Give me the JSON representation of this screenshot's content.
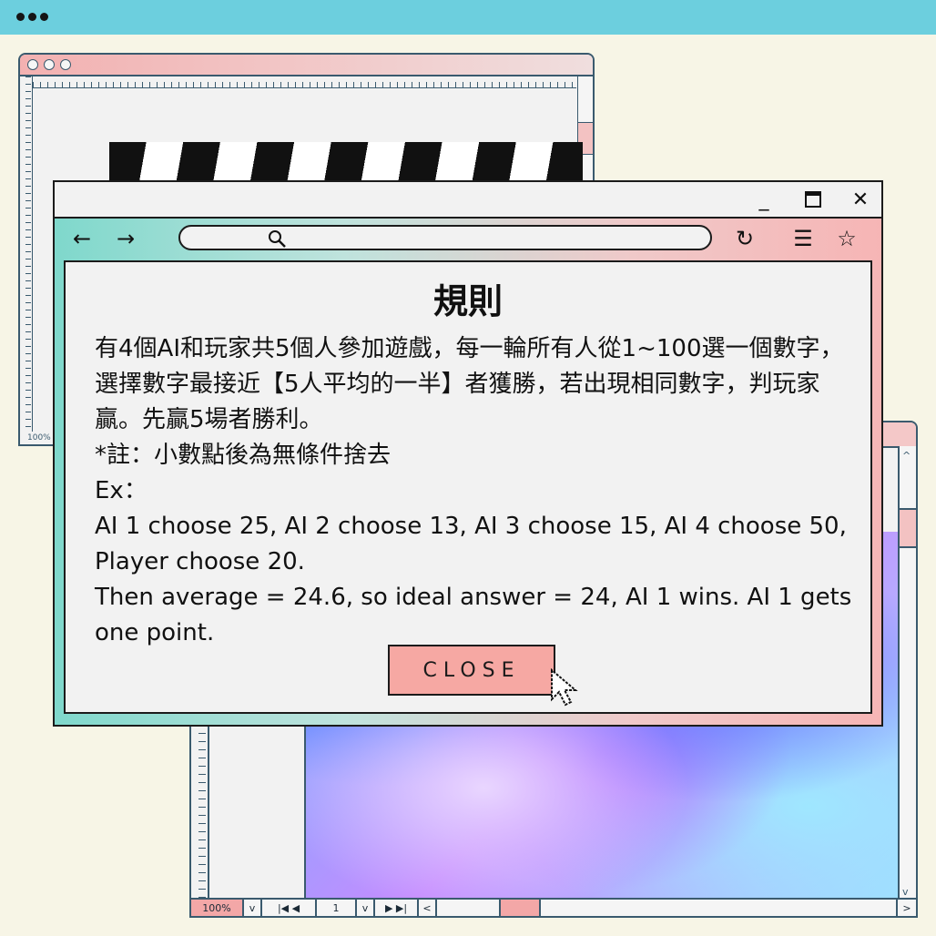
{
  "dialog": {
    "title": "規則",
    "paragraphs": [
      "有4個AI和玩家共5個人參加遊戲，每一輪所有人從1~100選一個數字，選擇數字最接近【5人平均的一半】者獲勝，若出現相同數字，判玩家贏。先贏5場者勝利。",
      "*註：小數點後為無條件捨去",
      "Ex：",
      "AI 1 choose 25, AI 2 choose 13, AI 3 choose 15, AI 4 choose 50, Player choose 20.",
      "Then average = 24.6, so ideal answer = 24, AI 1 wins. AI 1 gets one point."
    ],
    "close_label": "CLOSE"
  },
  "window_controls": {
    "minimize": "_",
    "maximize": "□",
    "close": "✕"
  },
  "nav": {
    "back": "←",
    "forward": "→",
    "reload": "↻",
    "menu": "☰",
    "star": "☆",
    "search": "🔍"
  },
  "back_window": {
    "zoom": "100%"
  },
  "lower_window": {
    "zoom": "100%",
    "page": "1"
  },
  "colors": {
    "topbar": "#6ccfde",
    "background": "#f7f5e6",
    "close_button": "#f6a8a3",
    "nav_gradient_start": "#7fd8cc",
    "nav_gradient_end": "#f6b5b5"
  }
}
